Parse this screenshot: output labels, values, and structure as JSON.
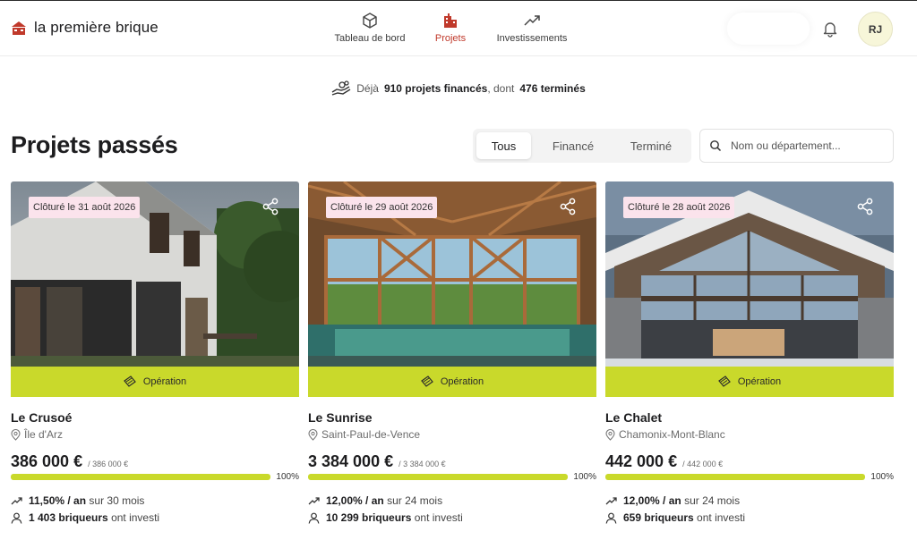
{
  "brand": {
    "name": "la première brique",
    "logo": "house-logo",
    "color": "#c0392b"
  },
  "nav": [
    {
      "label": "Tableau de bord",
      "icon": "cube-icon",
      "active": false
    },
    {
      "label": "Projets",
      "icon": "building-icon",
      "active": true
    },
    {
      "label": "Investissements",
      "icon": "trend-up-icon",
      "active": false
    }
  ],
  "user": {
    "initials": "RJ"
  },
  "stats": {
    "prefix": "Déjà",
    "financed": "910 projets financés",
    "middle": ", dont",
    "completed": "476 terminés"
  },
  "page": {
    "title": "Projets passés"
  },
  "filters": {
    "all": "Tous",
    "financed": "Financé",
    "completed": "Terminé",
    "selected": "Tous"
  },
  "search": {
    "placeholder": "Nom ou département..."
  },
  "colors": {
    "accent": "#c9d92b",
    "badge": "#fbe3ec",
    "brand": "#c0392b"
  },
  "projects": [
    {
      "badge": "Clôturé le 31 août 2026",
      "operation": "Opération",
      "name": "Le Crusoé",
      "location": "Île d'Arz",
      "amount": "386 000 €",
      "target": "/ 386 000 €",
      "progress": 100,
      "progress_label": "100%",
      "rate_value": "11,50% / an",
      "rate_duration": "sur 30 mois",
      "investors_count": "1 403 briqueurs",
      "investors_suffix": "ont investi"
    },
    {
      "badge": "Clôturé le 29 août 2026",
      "operation": "Opération",
      "name": "Le Sunrise",
      "location": "Saint-Paul-de-Vence",
      "amount": "3 384 000 €",
      "target": "/ 3 384 000 €",
      "progress": 100,
      "progress_label": "100%",
      "rate_value": "12,00% / an",
      "rate_duration": "sur 24 mois",
      "investors_count": "10 299 briqueurs",
      "investors_suffix": "ont investi"
    },
    {
      "badge": "Clôturé le 28 août 2026",
      "operation": "Opération",
      "name": "Le Chalet",
      "location": "Chamonix-Mont-Blanc",
      "amount": "442 000 €",
      "target": "/ 442 000 €",
      "progress": 100,
      "progress_label": "100%",
      "rate_value": "12,00% / an",
      "rate_duration": "sur 24 mois",
      "investors_count": "659 briqueurs",
      "investors_suffix": "ont investi"
    }
  ]
}
